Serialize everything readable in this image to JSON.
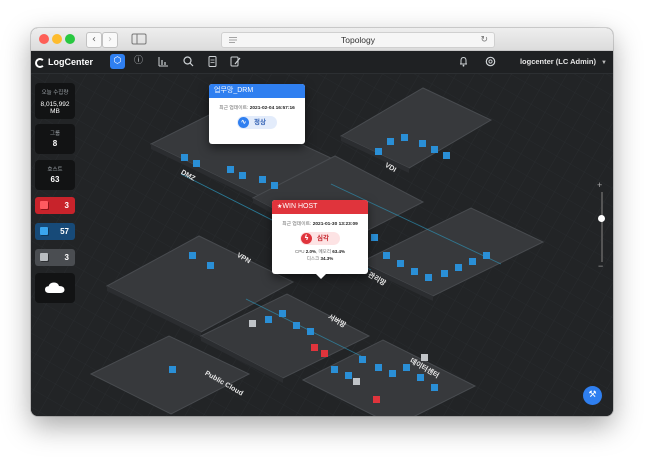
{
  "browser": {
    "url_title": "Topology"
  },
  "app": {
    "logo": "LogCenter",
    "user": "logcenter (LC Admin)"
  },
  "sidebar": {
    "total_label": "오늘 수집량",
    "total_value": "8,015,992 MB",
    "group_label": "그룹",
    "group_value": "8",
    "host_label": "호스트",
    "host_value": "63",
    "critical_count": "3",
    "normal_count": "57",
    "unknown_count": "3"
  },
  "zones": {
    "dmz": "DMZ",
    "vdi": "VDI",
    "vpn": "VPN",
    "server": "서버망",
    "management": "관리망",
    "datacenter": "데이터센터",
    "public_cloud": "Public Cloud"
  },
  "popup_drm": {
    "title": "업무망_DRM",
    "meta_label": "최근 업데이트:",
    "meta_value": "2021-02-04 16:57:16",
    "status": "정상"
  },
  "popup_win": {
    "title": "WIN HOST",
    "meta_label": "최근 업데이트:",
    "meta_value": "2021-01-30 13:23:09",
    "status": "심각",
    "cpu_label": "CPU",
    "cpu_value": "2.0%",
    "mem_label": "메모리",
    "mem_value": "63.4%",
    "disk_label": "디스크",
    "disk_value": "34.3%"
  },
  "colors": {
    "accent": "#2f7ff0",
    "critical": "#e0343c",
    "normal": "#2a8fd6",
    "unknown": "#8a8f94"
  }
}
